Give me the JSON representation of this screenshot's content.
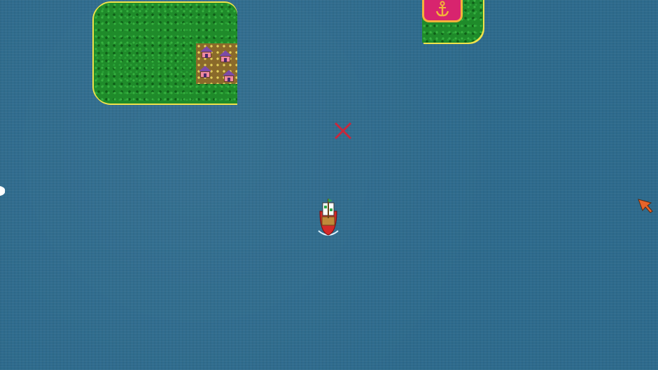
{
  "scene": {
    "water_color": "#2e6b8d",
    "grass_color": "#1f8b2a",
    "shore_color": "#f2e34a"
  },
  "islands": [
    {
      "name": "left-island",
      "has_village": true
    },
    {
      "name": "harbor-island",
      "has_port": true
    }
  ],
  "village": {
    "houses": 4,
    "roof_color": "#7b4aa8",
    "wall_color": "#f08aa3"
  },
  "port": {
    "icon": "anchor-icon",
    "sign_color": "#d8246e",
    "anchor_color": "#f2b23a"
  },
  "markers": {
    "destination_icon": "x-marker-icon",
    "destination_color": "#c8283c",
    "offscreen_pointer_icon": "arrow-pointer-icon",
    "offscreen_pointer_color": "#e8642a"
  },
  "player": {
    "icon": "sailboat-icon",
    "hull_color": "#d42a2a",
    "sail_color": "#ffffff"
  }
}
